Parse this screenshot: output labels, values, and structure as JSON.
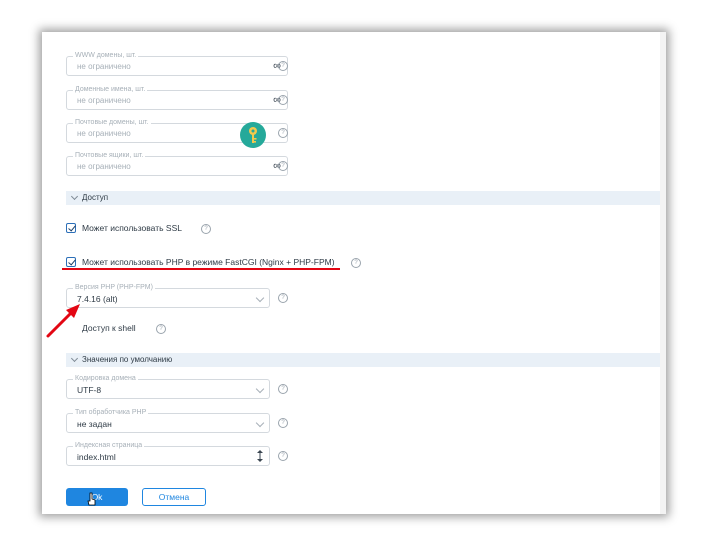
{
  "limits": [
    {
      "label": "WWW домены, шт.",
      "value": "не ограничено",
      "symbol": "∞"
    },
    {
      "label": "Доменные имена, шт.",
      "value": "не ограничено",
      "symbol": "∞"
    },
    {
      "label": "Почтовые домены, шт.",
      "value": "не ограничено",
      "symbol": "∞"
    },
    {
      "label": "Почтовые ящики, шт.",
      "value": "не ограничено",
      "symbol": "∞"
    }
  ],
  "access": {
    "section_title": "Доступ",
    "ssl_label": "Может использовать SSL",
    "ssl_checked": true,
    "php_label": "Может использовать PHP в режиме FastCGI (Nginx + PHP-FPM)",
    "php_checked": true,
    "php_version_label": "Версия PHP (PHP-FPM)",
    "php_version_value": "7.4.16 (alt)",
    "shell_label": "Доступ к shell",
    "shell_checked": false
  },
  "defaults": {
    "section_title": "Значения по умолчанию",
    "encoding_label": "Кодировка домена",
    "encoding_value": "UTF-8",
    "php_handler_label": "Тип обработчика PHP",
    "php_handler_value": "не задан",
    "index_label": "Индексная страница",
    "index_value": "index.html"
  },
  "buttons": {
    "ok": "Ok",
    "cancel": "Отмена"
  },
  "help_glyph": "?",
  "colors": {
    "accent": "#1f86e0",
    "annotation": "#e30613",
    "key_badge": "#25a99a"
  }
}
